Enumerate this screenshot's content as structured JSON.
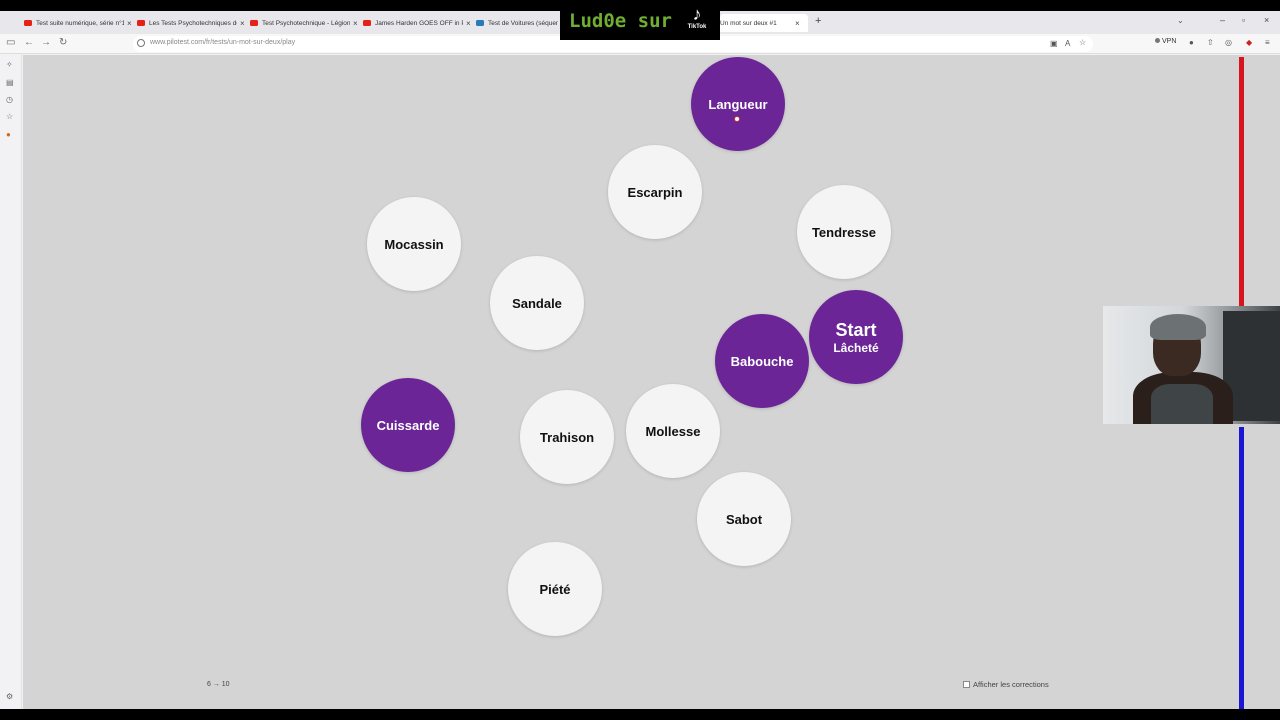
{
  "browser": {
    "tabs": [
      {
        "title": "Test suite numérique, série n°1",
        "icon": "youtube-icon"
      },
      {
        "title": "Les Tests Psychotechniques de l'A",
        "icon": "youtube-icon"
      },
      {
        "title": "Test Psychotechnique - Légion Étr",
        "icon": "youtube-icon"
      },
      {
        "title": "James Harden GOES OFF in Prov",
        "icon": "youtube-icon"
      },
      {
        "title": "Test de Voitures (séquentiel)",
        "icon": "pilotest-icon"
      },
      {
        "title": "Un mot sur deux #1",
        "icon": "pilotest-icon"
      }
    ],
    "url": "www.pilotest.com/fr/tests/un-mot-sur-deux/play",
    "vpn_label": "VPN"
  },
  "overlay": {
    "tiktok_text": "Lud0e sur",
    "tiktok_label": "TikTok"
  },
  "game": {
    "start_label": "Start",
    "start_word": "Lâcheté",
    "words": [
      "Langueur",
      "Escarpin",
      "Tendresse",
      "Mocassin",
      "Sandale",
      "Babouche",
      "Cuissarde",
      "Trahison",
      "Mollesse",
      "Sabot",
      "Piété"
    ],
    "counter": "6 → 10",
    "show_corrections_label": "Afficher les corrections",
    "colors": {
      "selected": "#6b2596",
      "unselected": "#f4f4f4",
      "background": "#d4d4d4"
    }
  }
}
